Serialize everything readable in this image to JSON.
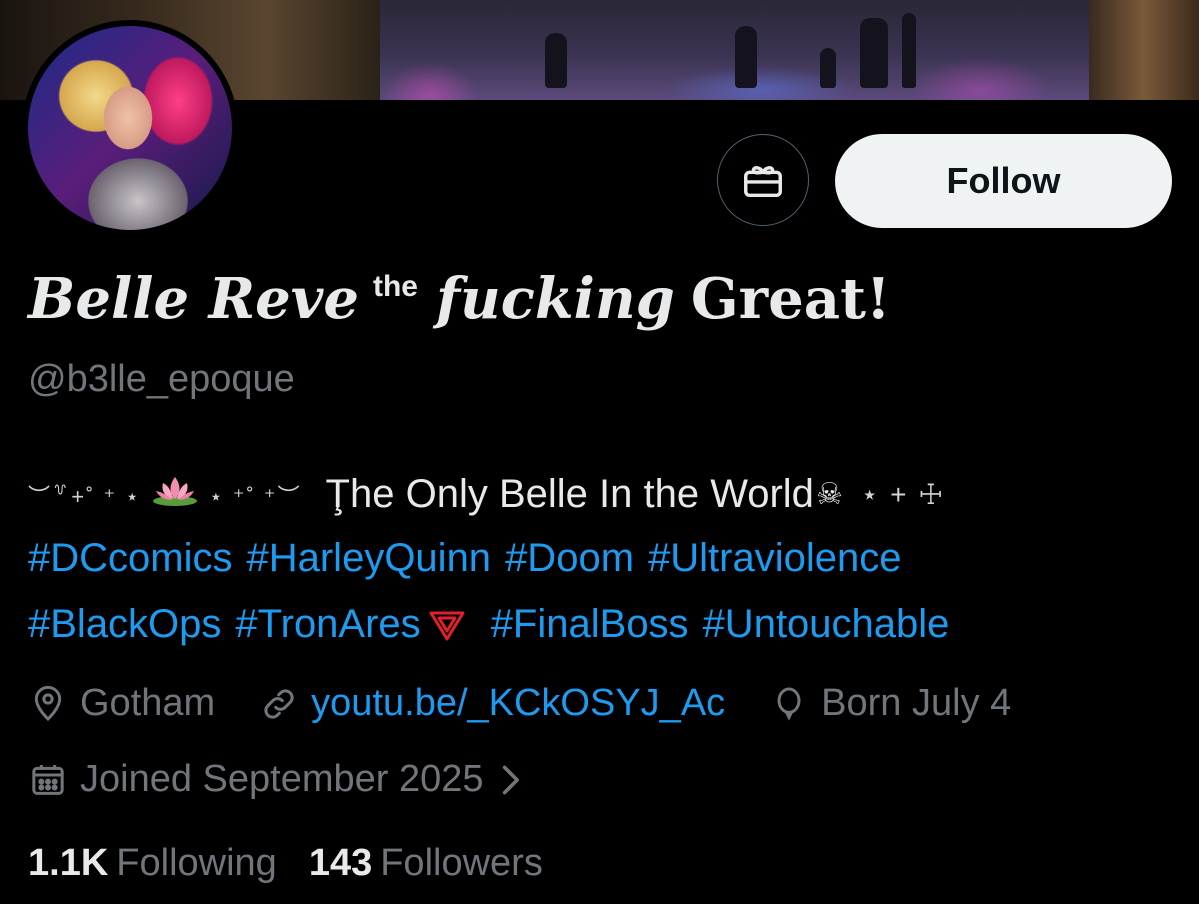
{
  "profile": {
    "display_name_part1": "Belle Reve",
    "display_name_sup": "the",
    "display_name_italic": "fucking",
    "display_name_part2": "Great!",
    "handle": "@b3lle_epoque"
  },
  "actions": {
    "gift_icon": "gift-icon",
    "follow_label": "Follow"
  },
  "bio": {
    "deco_left": "︶꒷+˚ ⁺ ⋆",
    "deco_mid": "⋆ ⁺˚ ⁺︶",
    "text": "Ţhe Only Belle In the World",
    "skull": "☠",
    "deco_right": "⋆ + ☩",
    "hashtags_line1": [
      "#DCcomics",
      "#HarleyQuinn",
      "#Doom",
      "#Ultraviolence"
    ],
    "hashtags_line2a": [
      "#BlackOps",
      "#TronAres"
    ],
    "hashtags_line2b": [
      "#FinalBoss",
      "#Untouchable"
    ]
  },
  "meta": {
    "location": "Gotham",
    "website": "youtu.be/_KCkOSYJ_Ac",
    "birthday": "Born July 4",
    "joined": "Joined September 2025"
  },
  "stats": {
    "following_count": "1.1K",
    "following_label": "Following",
    "followers_count": "143",
    "followers_label": "Followers"
  },
  "colors": {
    "background": "#000000",
    "text_primary": "#e7e9ea",
    "text_secondary": "#71767b",
    "link": "#1d9bf0",
    "follow_button_bg": "#eff3f4",
    "tron_logo": "#e0202a"
  }
}
